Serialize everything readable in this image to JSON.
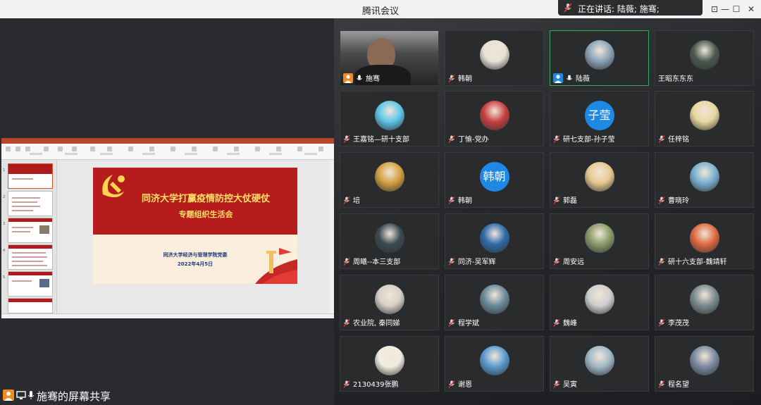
{
  "window": {
    "title": "腾讯会议",
    "speaking": "正在讲话: 陆薇; 施骞;"
  },
  "window_controls": {
    "pin": "⊡",
    "minimize": "—",
    "maximize": "☐",
    "close": "✕"
  },
  "share": {
    "label": "施骞的屏幕共享"
  },
  "slide": {
    "title_line1": "同济大学打赢疫情防控大仗硬仗",
    "title_line2": "专题组织生活会",
    "org": "同济大学经济与管理学院党委",
    "date": "2022年4月5日"
  },
  "participants": [
    {
      "name": "施骞",
      "avatar": "video",
      "muted": false,
      "host": true,
      "host_color": "#f08a24"
    },
    {
      "name": "韩朝",
      "avatar": "photo",
      "muted": true,
      "color": "#e8e2d6"
    },
    {
      "name": "陆薇",
      "avatar": "photo",
      "muted": false,
      "host": true,
      "host_color": "#1e88e5",
      "active": true,
      "color": "#8aa4b8"
    },
    {
      "name": "王昭东东东",
      "avatar": "photo",
      "muted": null,
      "color": "#4a5a50"
    },
    {
      "name": "王嘉铭—研十支部",
      "avatar": "photo",
      "muted": true,
      "color": "#5ec6ea"
    },
    {
      "name": "丁愉-党办",
      "avatar": "photo",
      "muted": true,
      "color": "#c84040"
    },
    {
      "name": "研七支部-孙子莹",
      "avatar": "text",
      "avatar_text": "子莹",
      "muted": true,
      "color": "#1e88e5"
    },
    {
      "name": "任梓铭",
      "avatar": "photo",
      "muted": true,
      "color": "#e8d8a0"
    },
    {
      "name": "培",
      "avatar": "photo",
      "muted": true,
      "color": "#d4a040"
    },
    {
      "name": "韩朝",
      "avatar": "text",
      "avatar_text": "韩朝",
      "muted": true,
      "color": "#1e88e5"
    },
    {
      "name": "郭磊",
      "avatar": "photo",
      "muted": true,
      "color": "#e8c890"
    },
    {
      "name": "曹晓玲",
      "avatar": "photo",
      "muted": true,
      "color": "#7ab0d0"
    },
    {
      "name": "周曦--本三支部",
      "avatar": "photo",
      "muted": true,
      "color": "#3a4a52"
    },
    {
      "name": "同济-吴军辉",
      "avatar": "photo",
      "muted": true,
      "color": "#2e6aa8"
    },
    {
      "name": "周安远",
      "avatar": "photo",
      "muted": true,
      "color": "#8a9a6a"
    },
    {
      "name": "研十六支部-魏靖轩",
      "avatar": "photo",
      "muted": true,
      "color": "#e06a40"
    },
    {
      "name": "农业院, 秦同娣",
      "avatar": "photo",
      "muted": true,
      "color": "#d8d0c8"
    },
    {
      "name": "程学斌",
      "avatar": "photo",
      "muted": true,
      "color": "#6a8a9a"
    },
    {
      "name": "魏峰",
      "avatar": "photo",
      "muted": true,
      "color": "#cfcfcf"
    },
    {
      "name": "李茂茂",
      "avatar": "photo",
      "muted": true,
      "color": "#7a8a90"
    },
    {
      "name": "2130439张鹏",
      "avatar": "photo",
      "muted": true,
      "color": "#f0eee0"
    },
    {
      "name": "谢恩",
      "avatar": "photo",
      "muted": true,
      "color": "#5a9ad0"
    },
    {
      "name": "吴寅",
      "avatar": "photo",
      "muted": true,
      "color": "#a0b8c8"
    },
    {
      "name": "程名望",
      "avatar": "photo",
      "muted": true,
      "color": "#7a8aa0"
    }
  ]
}
